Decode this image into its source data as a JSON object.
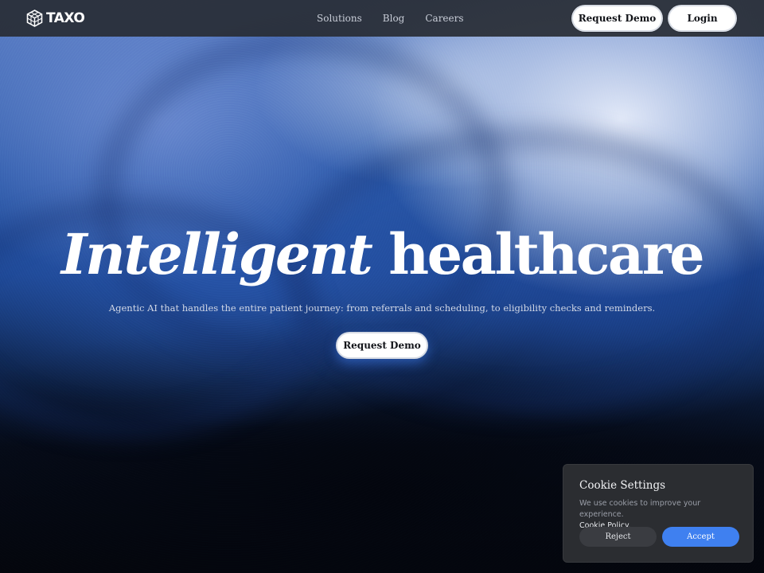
{
  "header": {
    "brand": "TAXO",
    "nav": [
      {
        "label": "Solutions"
      },
      {
        "label": "Blog"
      },
      {
        "label": "Careers"
      }
    ],
    "request_demo_label": "Request Demo",
    "login_label": "Login"
  },
  "hero": {
    "title_italic": "Intelligent",
    "title_rest": "healthcare",
    "subtitle": "Agentic AI that handles the entire patient journey: from referrals and scheduling, to eligibility checks and reminders.",
    "cta_label": "Request Demo"
  },
  "cookie": {
    "title": "Cookie Settings",
    "description": "We use cookies to improve your experience.",
    "policy_link": "Cookie Policy",
    "reject_label": "Reject",
    "accept_label": "Accept"
  },
  "colors": {
    "accent": "#3f80f0",
    "navbar_bg": "#282c34",
    "cookie_bg": "#2b2d31"
  },
  "icons": {
    "logo": "cube-logo-icon"
  }
}
